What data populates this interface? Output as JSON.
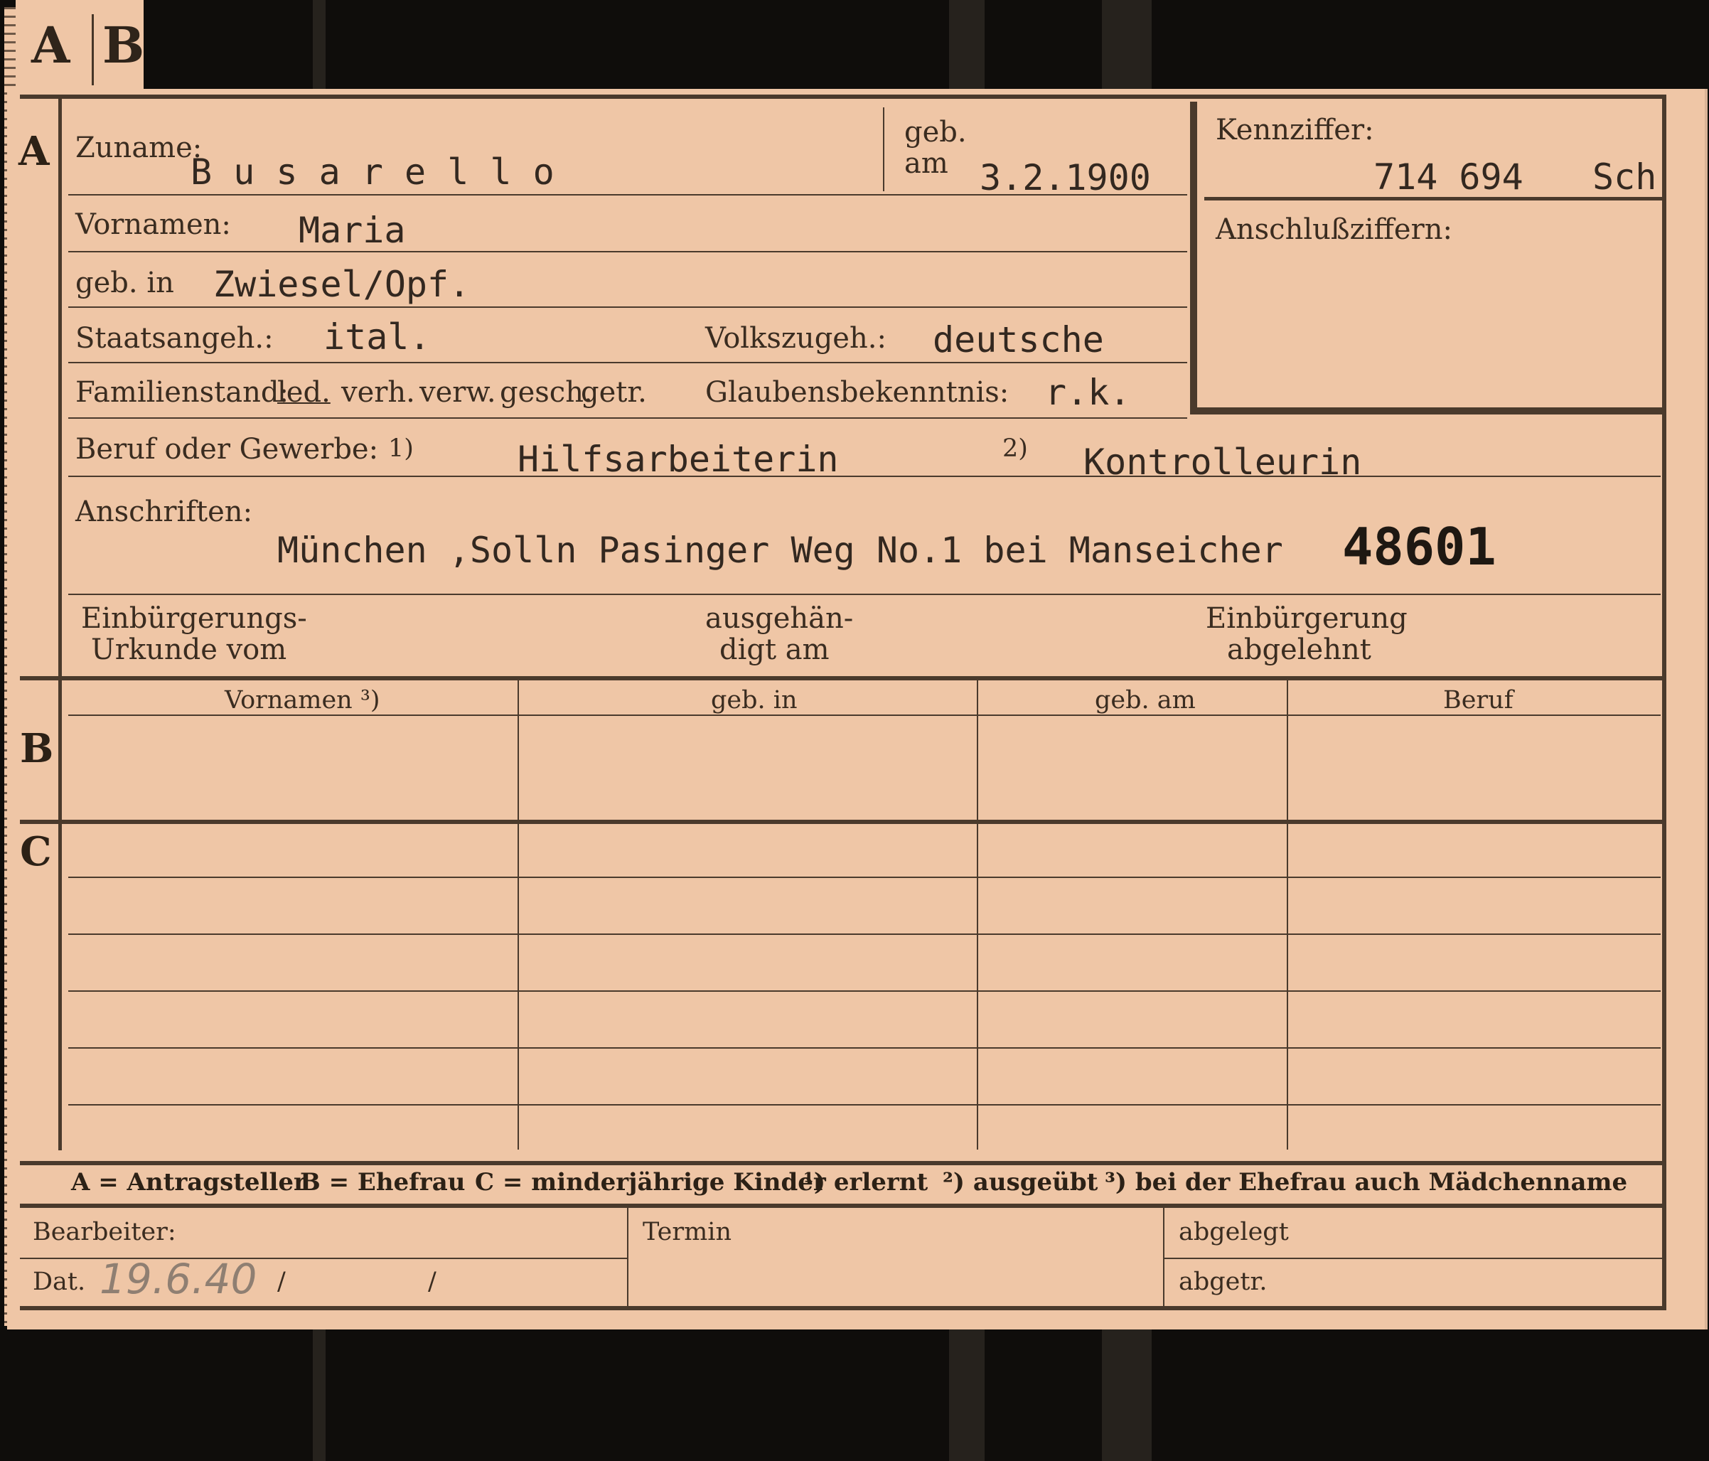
{
  "tab": {
    "letter_a": "A",
    "letter_b": "B"
  },
  "sections": {
    "a": "A",
    "b": "B",
    "c": "C"
  },
  "labels": {
    "zuname": "Zuname:",
    "geb_am_1": "geb.",
    "geb_am_2": "am",
    "kennziffer": "Kennziffer:",
    "anschlussziffern": "Anschlußziffern:",
    "vornamen": "Vornamen:",
    "geb_in": "geb. in",
    "staatsangeh": "Staatsangeh.:",
    "volkszugeh": "Volkszugeh.:",
    "familienstand": "Familienstand:",
    "familienstand_options": [
      {
        "text": "led.",
        "marked": true
      },
      {
        "text": "verh.",
        "marked": false
      },
      {
        "text": "verw.",
        "marked": false
      },
      {
        "text": "gesch.",
        "marked": false
      },
      {
        "text": "getr.",
        "marked": false
      }
    ],
    "glaubensbekenntnis": "Glaubensbekenntnis:",
    "beruf": "Beruf oder Gewerbe:",
    "fn1": "1)",
    "fn2": "2)",
    "anschriften": "Anschriften:",
    "einbuergerungs_1": "Einbürgerungs-",
    "einbuergerungs_2": "Urkunde vom",
    "ausgehaen_1": "ausgehän-",
    "ausgehaen_2": "digt am",
    "einbuergerung_1": "Einbürgerung",
    "einbuergerung_2": "abgelehnt",
    "bearbeiter": "Bearbeiter:",
    "dat": "Dat.",
    "termin": "Termin",
    "abgelegt": "abgelegt",
    "abgetr": "abgetr."
  },
  "values": {
    "zuname": "B u s a r e l l o",
    "geb_am": "3.2.1900",
    "kennziffer_num": "714 694",
    "kennziffer_suffix": "Sch",
    "vornamen": "Maria",
    "geb_in": "Zwiesel/Opf.",
    "staatsangeh": "ital.",
    "volkszugeh": "deutsche",
    "glaubensbekenntnis": "r.k.",
    "beruf_erlernt": "Hilfsarbeiterin",
    "beruf_ausgeuebt": "Kontrolleurin",
    "anschrift": "München ,Solln Pasinger Weg No.1 bei Manseicher",
    "stamp_number": "48601",
    "dat_handwritten": "19.6.40",
    "dat_slash_1": "/",
    "dat_slash_2": "/"
  },
  "table": {
    "headers": [
      "Vornamen ³)",
      "geb. in",
      "geb. am",
      "Beruf"
    ]
  },
  "legend": {
    "items": [
      "A = Antragsteller",
      "B = Ehefrau",
      "C = minderjährige Kinder",
      "¹) erlernt",
      "²) ausgeübt",
      "³) bei der Ehefrau auch Mädchenname"
    ]
  },
  "colors": {
    "card": "#efc6a6",
    "ink": "#2c2116",
    "background": "#0f0d0b",
    "pencil": "#8f7f72"
  }
}
